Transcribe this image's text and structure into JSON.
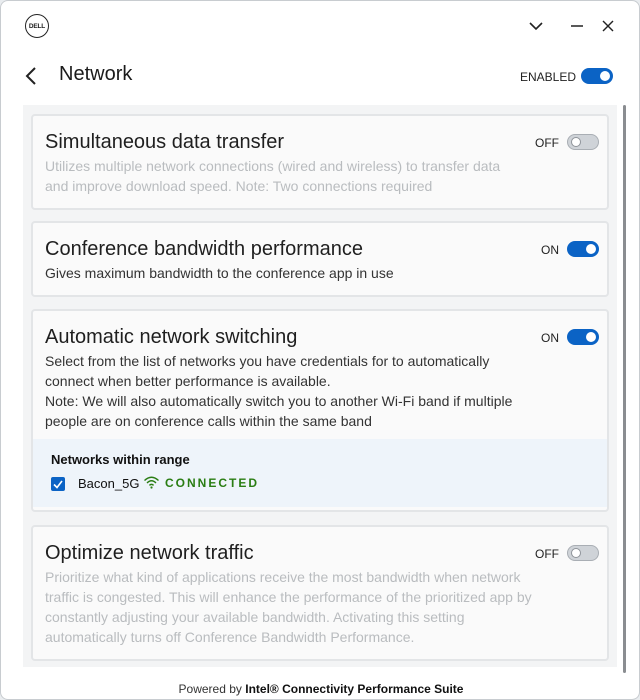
{
  "titlebar": {
    "logo_text": "DELL"
  },
  "header": {
    "title": "Network",
    "master_toggle_label": "ENABLED",
    "master_toggle_on": true
  },
  "cards": [
    {
      "title": "Simultaneous data transfer",
      "state_label": "OFF",
      "on": false,
      "description": "Utilizes multiple network connections (wired and wireless) to transfer data and improve download speed. Note: Two connections required"
    },
    {
      "title": "Conference bandwidth performance",
      "state_label": "ON",
      "on": true,
      "description": "Gives maximum bandwidth to the conference app in use"
    },
    {
      "title": "Automatic network switching",
      "state_label": "ON",
      "on": true,
      "description": "Select from the list of networks you have credentials for to automatically connect when better performance is available.",
      "note": "Note: We will also automatically switch you to another Wi-Fi band if multiple people are on conference calls within the same band",
      "networks": {
        "title": "Networks within range",
        "items": [
          {
            "name": "Bacon_5G",
            "checked": true,
            "status": "CONNECTED"
          }
        ]
      }
    },
    {
      "title": "Optimize network traffic",
      "state_label": "OFF",
      "on": false,
      "description": "Prioritize what kind of applications receive the most bandwidth when network traffic is congested. This will enhance the performance of the prioritized app by constantly adjusting your available bandwidth. Activating this setting automatically turns off Conference Bandwidth Performance."
    }
  ],
  "footer": {
    "prefix": "Powered by",
    "product": "Intel® Connectivity Performance Suite"
  },
  "colors": {
    "accent": "#0b63c5",
    "connected": "#2a7d13",
    "muted_text": "#b9bcbf"
  }
}
